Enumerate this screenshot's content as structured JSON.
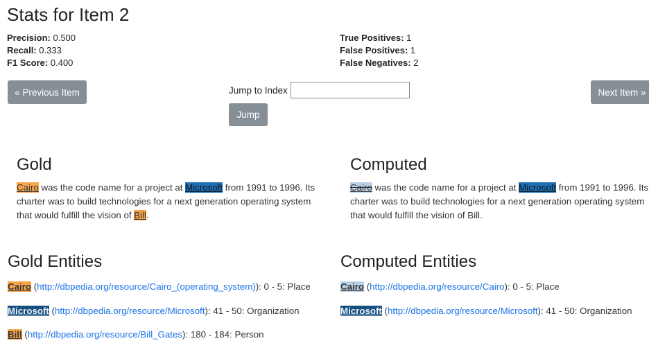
{
  "page": {
    "title": "Stats for Item 2"
  },
  "stats": {
    "precision_label": "Precision:",
    "precision_value": "0.500",
    "recall_label": "Recall:",
    "recall_value": "0.333",
    "f1_label": "F1 Score:",
    "f1_value": "0.400",
    "tp_label": "True Positives:",
    "tp_value": "1",
    "fp_label": "False Positives:",
    "fp_value": "1",
    "fn_label": "False Negatives:",
    "fn_value": "2"
  },
  "nav": {
    "prev_label": "« Previous Item",
    "next_label": "Next Item »",
    "jump_label": "Jump to Index",
    "jump_button": "Jump",
    "jump_value": ""
  },
  "gold": {
    "title": "Gold",
    "t_cairo": "Cairo",
    "t1": " was the code name for a project at ",
    "t_microsoft": "Microsoft",
    "t2": " from 1991 to 1996. Its charter was to build technologies for a next generation operating system that would fulfill the vision of ",
    "t_bill": "Bill",
    "t3": "."
  },
  "computed": {
    "title": "Computed",
    "t_cairo": "Cairo",
    "t1": " was the code name for a project at ",
    "t_microsoft": "Microsoft",
    "t2": " from 1991 to 1996. Its charter was to build technologies for a next generation operating system that would fulfill the vision of Bill."
  },
  "gold_entities": {
    "title": "Gold Entities",
    "items": [
      {
        "name": "Cairo",
        "url": "http://dbpedia.org/resource/Cairo_(operating_system)",
        "span": ": 0 - 5: Place"
      },
      {
        "name": "Microsoft",
        "url": "http://dbpedia.org/resource/Microsoft",
        "span": ": 41 - 50: Organization"
      },
      {
        "name": "Bill",
        "url": "http://dbpedia.org/resource/Bill_Gates",
        "span": ": 180 - 184: Person"
      }
    ]
  },
  "computed_entities": {
    "title": "Computed Entities",
    "items": [
      {
        "name": "Cairo",
        "url": "http://dbpedia.org/resource/Cairo",
        "span": ": 0 - 5: Place"
      },
      {
        "name": "Microsoft",
        "url": "http://dbpedia.org/resource/Microsoft",
        "span": ": 41 - 50: Organization"
      }
    ]
  },
  "colors": {
    "button_gray": "#868e96",
    "entity_orange": "#f7a54a",
    "entity_blue": "#1f6fb2",
    "entity_lightblue": "#b9cfe6",
    "link_blue": "#1a73e8"
  }
}
